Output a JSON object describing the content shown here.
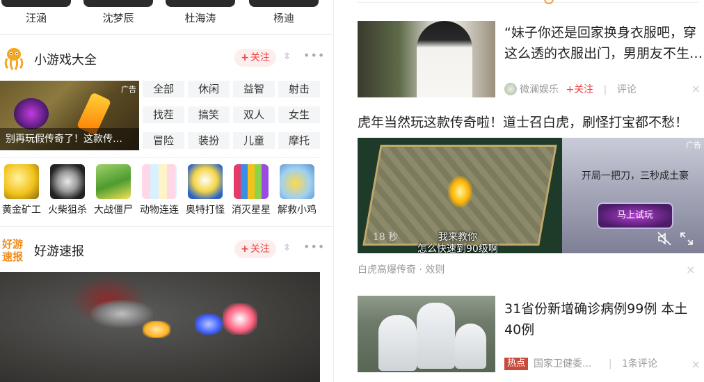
{
  "people": [
    "汪涵",
    "沈梦辰",
    "杜海涛",
    "杨迪"
  ],
  "games_section": {
    "title": "小游戏大全",
    "follow_label": "关注",
    "follow_plus": "+",
    "swap_glyph": "⇳",
    "more_glyph": "•••",
    "ad": {
      "tag": "广告",
      "caption": "别再玩假传奇了！这款传…"
    },
    "categories": [
      "全部",
      "休闲",
      "益智",
      "射击",
      "找茬",
      "搞笑",
      "双人",
      "女生",
      "冒险",
      "装扮",
      "儿童",
      "摩托"
    ],
    "mini_games": [
      "黄金矿工",
      "火柴狙杀",
      "大战僵尸",
      "动物连连",
      "奥特打怪",
      "消灭星星",
      "解救小鸡"
    ]
  },
  "haoyou_section": {
    "logo_text": "好游速报",
    "title": "好游速报",
    "follow_label": "关注",
    "follow_plus": "+",
    "swap_glyph": "⇳",
    "more_glyph": "•••"
  },
  "feed": {
    "item1": {
      "title": "“妹子你还是回家换身衣服吧，穿这么透的衣服出门，男朋友不生…",
      "source": "微澜娱乐",
      "follow": "+关注",
      "divider": "|",
      "comment": "评论",
      "close": "×"
    },
    "ad": {
      "title": "虎年当然玩这款传奇啦！道士召白虎，刷怪打宝都不愁！",
      "timer": "18 秒",
      "subtitle1": "我来教你",
      "subtitle2": "怎么快速到90级啊",
      "tag": "广告",
      "slogan": "开局一把刀，三秒成土豪",
      "button": "马上试玩",
      "meta": "白虎高爆传奇 · 效则",
      "close": "×"
    },
    "item2": {
      "title": "31省份新增确诊病例99例 本土40例",
      "hot_badge": "热点",
      "source": "国家卫健委...",
      "divider": "|",
      "comment": "1条评论",
      "close": "×"
    }
  },
  "colors": {
    "accent_red": "#f04142",
    "follow_bg": "#fdeeee",
    "meta_gray": "#999999",
    "hot_badge": "#c94a3a"
  }
}
